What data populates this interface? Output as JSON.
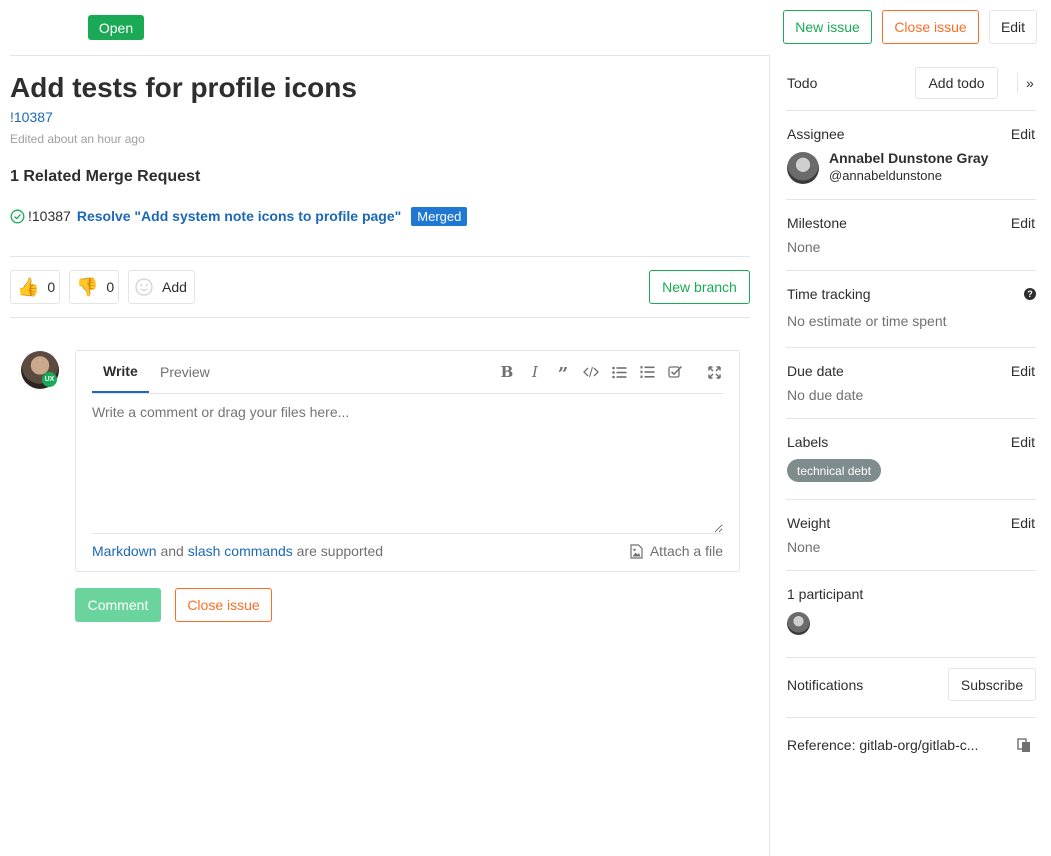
{
  "header": {
    "status_badge": "Open",
    "new_issue": "New issue",
    "close_issue": "Close issue",
    "edit": "Edit"
  },
  "issue": {
    "title": "Add tests for profile icons",
    "reference": "!10387",
    "edited": "Edited about an hour ago"
  },
  "related": {
    "heading": "1 Related Merge Request",
    "mr_ref": "!10387",
    "mr_title": "Resolve \"Add system note icons to profile page\"",
    "mr_status": "Merged"
  },
  "awards": {
    "thumbs_up_count": "0",
    "thumbs_down_count": "0",
    "add_label": "Add",
    "new_branch": "New branch"
  },
  "comment": {
    "avatar_badge": "UX",
    "tab_write": "Write",
    "tab_preview": "Preview",
    "placeholder": "Write a comment or drag your files here...",
    "footer_markdown": "Markdown",
    "footer_and": "and",
    "footer_slash": "slash commands",
    "footer_supported": "are supported",
    "attach": "Attach a file",
    "comment_button": "Comment",
    "close_button": "Close issue"
  },
  "sidebar": {
    "todo_label": "Todo",
    "add_todo": "Add todo",
    "assignee_title": "Assignee",
    "assignee_edit": "Edit",
    "assignee_name": "Annabel Dunstone Gray",
    "assignee_username": "@annabeldunstone",
    "milestone_title": "Milestone",
    "milestone_edit": "Edit",
    "milestone_value": "None",
    "time_title": "Time tracking",
    "time_value": "No estimate or time spent",
    "due_title": "Due date",
    "due_edit": "Edit",
    "due_value": "No due date",
    "labels_title": "Labels",
    "labels_edit": "Edit",
    "label_tag": "technical debt",
    "weight_title": "Weight",
    "weight_edit": "Edit",
    "weight_value": "None",
    "participants_title": "1 participant",
    "notifications_title": "Notifications",
    "subscribe": "Subscribe",
    "reference": "Reference: gitlab-org/gitlab-c..."
  },
  "colors": {
    "green": "#1aaa55",
    "orange": "#fc6d26",
    "link": "#1b69b6",
    "merged_badge": "#1f78d1",
    "label_bg": "#7f8c8d"
  }
}
